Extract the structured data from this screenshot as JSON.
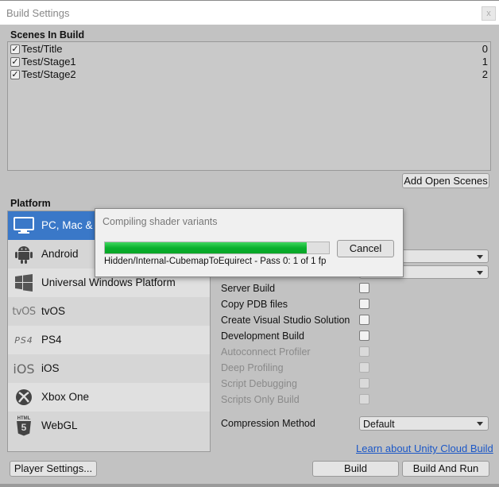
{
  "window": {
    "title": "Build Settings",
    "close_glyph": "x"
  },
  "scenes": {
    "label": "Scenes In Build",
    "items": [
      {
        "name": "Test/Title",
        "index": "0",
        "checked": true
      },
      {
        "name": "Test/Stage1",
        "index": "1",
        "checked": true
      },
      {
        "name": "Test/Stage2",
        "index": "2",
        "checked": true
      }
    ],
    "add_open_scenes": "Add Open Scenes"
  },
  "platform": {
    "label": "Platform",
    "items": [
      {
        "label": "PC, Mac &",
        "icon": "monitor-icon",
        "selected": true
      },
      {
        "label": "Android",
        "icon": "android-icon"
      },
      {
        "label": "Universal Windows Platform",
        "icon": "windows-icon"
      },
      {
        "label": "tvOS",
        "icon": "tvos-icon",
        "icon_text": "tvOS"
      },
      {
        "label": "PS4",
        "icon": "ps4-icon",
        "icon_text": "PS4"
      },
      {
        "label": "iOS",
        "icon": "ios-icon",
        "icon_text": "iOS"
      },
      {
        "label": "Xbox One",
        "icon": "xbox-icon"
      },
      {
        "label": "WebGL",
        "icon": "html5-icon",
        "icon_text": "HTML",
        "icon_number": "5"
      }
    ]
  },
  "options": {
    "server_build": "Server Build",
    "copy_pdb": "Copy PDB files",
    "create_vs_solution": "Create Visual Studio Solution",
    "development_build": "Development Build",
    "autoconnect_profiler": "Autoconnect Profiler",
    "deep_profiling": "Deep Profiling",
    "script_debugging": "Script Debugging",
    "scripts_only_build": "Scripts Only Build",
    "compression_method": "Compression Method",
    "compression_value": "Default"
  },
  "links": {
    "cloud_build": "Learn about Unity Cloud Build"
  },
  "buttons": {
    "player_settings": "Player Settings...",
    "build": "Build",
    "build_and_run": "Build And Run"
  },
  "progress": {
    "title": "Compiling shader variants",
    "cancel": "Cancel",
    "info": "Hidden/Internal-CubemapToEquirect - Pass 0: 1 of 1 fp",
    "fraction": 0.9
  },
  "colors": {
    "selection": "#3a78c8",
    "progress_fill": "#0bb02e",
    "link": "#1b57c7"
  }
}
